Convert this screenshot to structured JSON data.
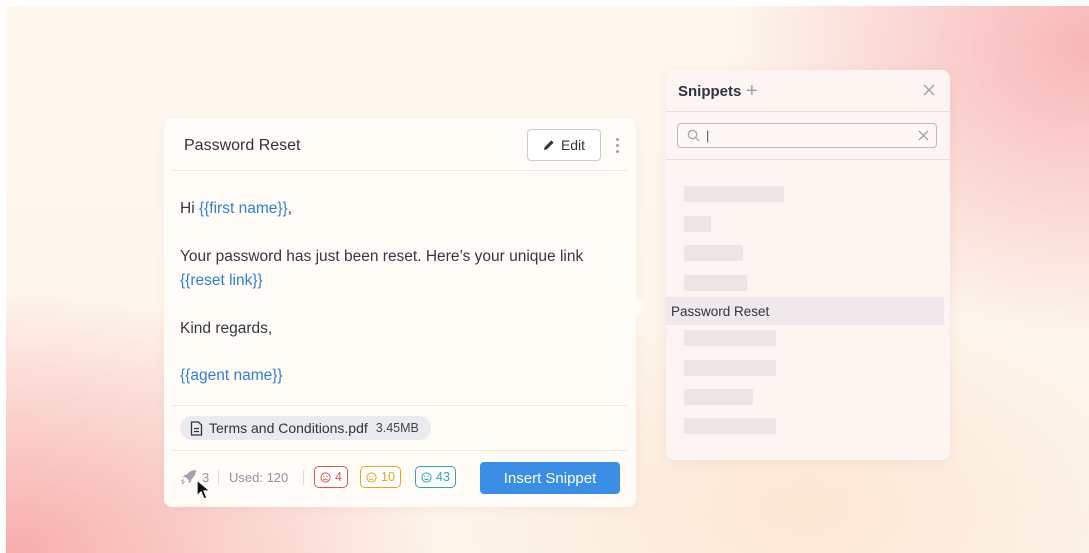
{
  "snippet": {
    "title": "Password Reset",
    "edit_label": "Edit",
    "body": {
      "greeting_prefix": "Hi ",
      "first_name_var": "{{first name}}",
      "greeting_suffix": ",",
      "line2": "Your password has just been reset. Here’s your unique link",
      "reset_link_var": "{{reset link}}",
      "closing": "Kind regards,",
      "agent_name_var": "{{agent name}}"
    },
    "attachment": {
      "name": "Terms and Conditions.pdf",
      "size": "3.45MB"
    },
    "footer": {
      "rocket_count": "3",
      "used_label": "Used: 120",
      "sad_count": "4",
      "neutral_count": "10",
      "happy_count": "43",
      "insert_label": "Insert Snippet"
    }
  },
  "panel": {
    "title": "Snippets",
    "plus": "+",
    "search_value": "|",
    "selected_item": "Password Reset"
  },
  "colors": {
    "accent": "#3a8ee6",
    "variable": "#2f7fd8",
    "sad": "#e2554d",
    "neutral": "#e9a31c",
    "happy": "#2fa7a4"
  }
}
